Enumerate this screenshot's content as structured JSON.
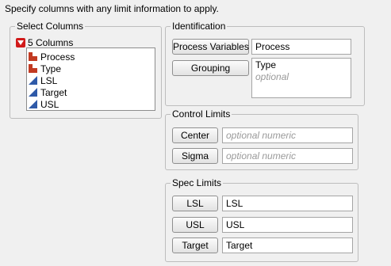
{
  "instructions": "Specify columns with any limit information to apply.",
  "select_columns": {
    "title": "Select Columns",
    "count_label": "5 Columns",
    "columns": [
      {
        "name": "Process",
        "type": "nominal"
      },
      {
        "name": "Type",
        "type": "nominal"
      },
      {
        "name": "LSL",
        "type": "continuous"
      },
      {
        "name": "Target",
        "type": "continuous"
      },
      {
        "name": "USL",
        "type": "continuous"
      }
    ]
  },
  "identification": {
    "title": "Identification",
    "process_variables_label": "Process Variables",
    "process_variables_value": "Process",
    "grouping_label": "Grouping",
    "grouping_value": "Type",
    "grouping_placeholder": "optional"
  },
  "control_limits": {
    "title": "Control Limits",
    "center_label": "Center",
    "center_placeholder": "optional numeric",
    "sigma_label": "Sigma",
    "sigma_placeholder": "optional numeric"
  },
  "spec_limits": {
    "title": "Spec Limits",
    "lsl_label": "LSL",
    "lsl_value": "LSL",
    "usl_label": "USL",
    "usl_value": "USL",
    "target_label": "Target",
    "target_value": "Target"
  },
  "colors": {
    "nominal_icon": "#c23a22",
    "continuous_icon": "#2f5aa8",
    "disclosure": "#d11a1a"
  }
}
